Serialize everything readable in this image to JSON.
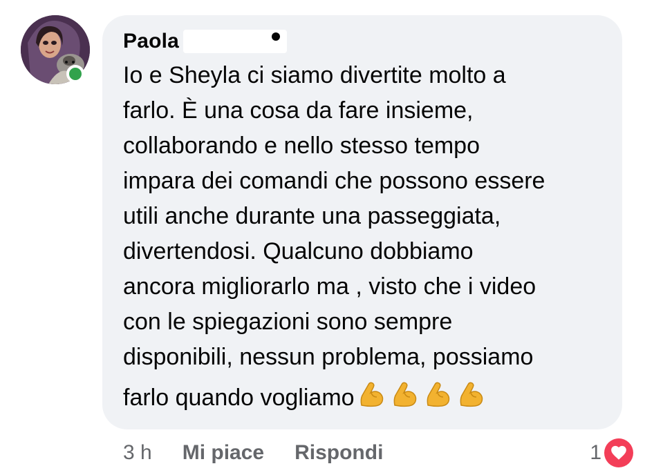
{
  "comment": {
    "author": "Paola",
    "online": true,
    "text_lines": [
      "Io e Sheyla ci siamo divertite molto a",
      "farlo. È una cosa da fare insieme,",
      "collaborando e nello stesso tempo",
      "impara dei comandi che possono essere",
      "utili anche durante una passeggiata,",
      "divertendosi. Qualcuno dobbiamo",
      "ancora migliorarlo ma , visto che i video",
      "con le spiegazioni sono sempre",
      "disponibili, nessun problema, possiamo",
      "farlo quando vogliamo"
    ],
    "emoji": [
      "flexed-biceps-icon",
      "flexed-biceps-icon",
      "flexed-biceps-icon",
      "flexed-biceps-icon"
    ]
  },
  "actions": {
    "time": "3 h",
    "like_label": "Mi piace",
    "reply_label": "Rispondi"
  },
  "reactions": {
    "count": "1",
    "type": "heart-reaction-icon"
  },
  "colors": {
    "bubble": "#f0f2f5",
    "online": "#31a24c",
    "heart": "#f33e58",
    "meta_text": "#65676b"
  }
}
